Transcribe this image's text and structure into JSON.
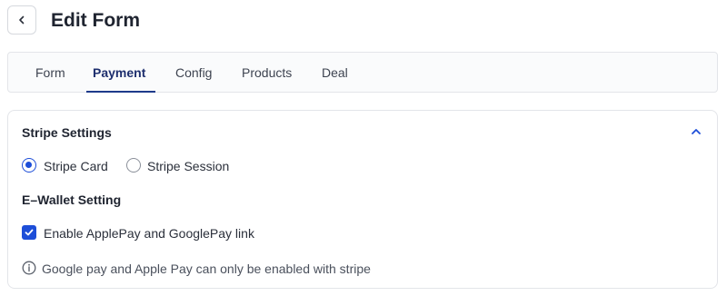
{
  "header": {
    "title": "Edit Form",
    "back_icon": "chevron-left-icon"
  },
  "tabs": [
    {
      "label": "Form",
      "active": false
    },
    {
      "label": "Payment",
      "active": true
    },
    {
      "label": "Config",
      "active": false
    },
    {
      "label": "Products",
      "active": false
    },
    {
      "label": "Deal",
      "active": false
    }
  ],
  "stripe": {
    "heading": "Stripe Settings",
    "collapse_icon": "chevron-up-icon",
    "options": [
      {
        "label": "Stripe Card",
        "selected": true
      },
      {
        "label": "Stripe Session",
        "selected": false
      }
    ]
  },
  "ewallet": {
    "heading": "E–Wallet Setting",
    "checkbox_label": "Enable ApplePay and GooglePay link",
    "checked": true,
    "info_icon": "info-icon",
    "info_text": "Google pay and Apple Pay can only be enabled with stripe"
  },
  "colors": {
    "accent": "#1d4ed8",
    "active_tab": "#1e2f6e"
  }
}
